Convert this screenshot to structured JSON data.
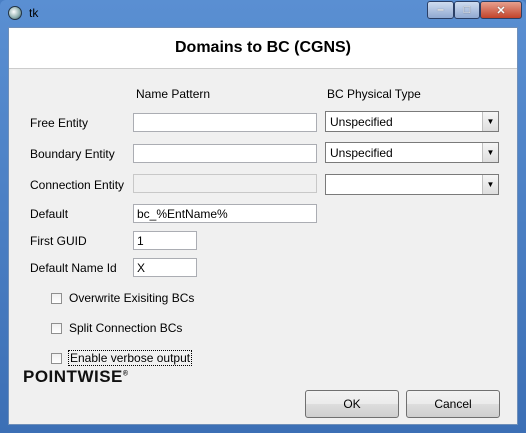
{
  "window": {
    "title": "tk",
    "min_glyph": "‒",
    "max_glyph": "□",
    "close_glyph": "✕"
  },
  "dialog": {
    "heading": "Domains to BC (CGNS)",
    "col_name_pattern": "Name Pattern",
    "col_bc_type": "BC Physical Type"
  },
  "rows": {
    "free_entity": {
      "label": "Free Entity",
      "name_value": "",
      "bc_type": "Unspecified"
    },
    "boundary_entity": {
      "label": "Boundary Entity",
      "name_value": "",
      "bc_type": "Unspecified"
    },
    "connection_entity": {
      "label": "Connection Entity",
      "name_value": "",
      "bc_type": ""
    }
  },
  "fields": {
    "default_label": "Default",
    "default_value": "bc_%EntName%",
    "first_guid_label": "First GUID",
    "first_guid_value": "1",
    "default_name_id_label": "Default Name Id",
    "default_name_id_value": "X"
  },
  "options": {
    "overwrite": {
      "label": "Overwrite Exisiting BCs",
      "checked": false
    },
    "split": {
      "label": "Split Connection BCs",
      "checked": false
    },
    "verbose": {
      "label": "Enable verbose output",
      "checked": false
    }
  },
  "buttons": {
    "ok": "OK",
    "cancel": "Cancel"
  },
  "logo": {
    "text": "POINTWISE",
    "mark": "®"
  }
}
